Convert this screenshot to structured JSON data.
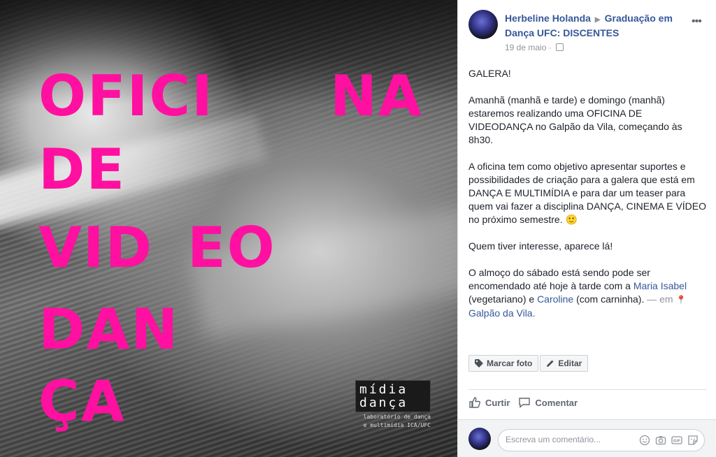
{
  "image": {
    "lines": [
      "OFICI",
      "NA",
      "DE",
      "VID",
      "EO",
      "DAN",
      "ÇA"
    ],
    "logo": {
      "line1": "mídia",
      "line2": "dança",
      "sub1": "laboratório de dança",
      "sub2": "e multimídia ICA/UFC"
    },
    "accent_color": "#ff10a0"
  },
  "post": {
    "author": "Herbeline Holanda",
    "group": "Graduação em Dança UFC: DISCENTES",
    "date": "19 de maio",
    "more": "•••",
    "paragraphs": {
      "p1": "GALERA!",
      "p2": "Amanhã (manhã e tarde) e domingo (manhã) estaremos realizando uma OFICINA DE VIDEODANÇA no Galpão da Vila, começando às 8h30.",
      "p3": "A oficina tem como objetivo apresentar suportes e possibilidades de criação para a galera que está em DANÇA E MULTIMÍDIA e para dar um teaser para quem vai fazer a disciplina DANÇA, CINEMA E VÍDEO no próximo semestre. 🙂",
      "p4": "Quem tiver interesse, aparece lá!",
      "p5_a": "O almoço do sábado está sendo pode ser encomendado até hoje à tarde com a ",
      "p5_link1": "Maria Isabel",
      "p5_b": " (vegetariano) e ",
      "p5_link2": "Caroline",
      "p5_c": " (com carninha). ",
      "p5_em": "— em ",
      "p5_place": "Galpão da Vila."
    },
    "buttons": {
      "tag": "Marcar foto",
      "edit": "Editar"
    },
    "actions": {
      "like": "Curtir",
      "comment": "Comentar"
    },
    "comment_placeholder": "Escreva um comentário..."
  }
}
